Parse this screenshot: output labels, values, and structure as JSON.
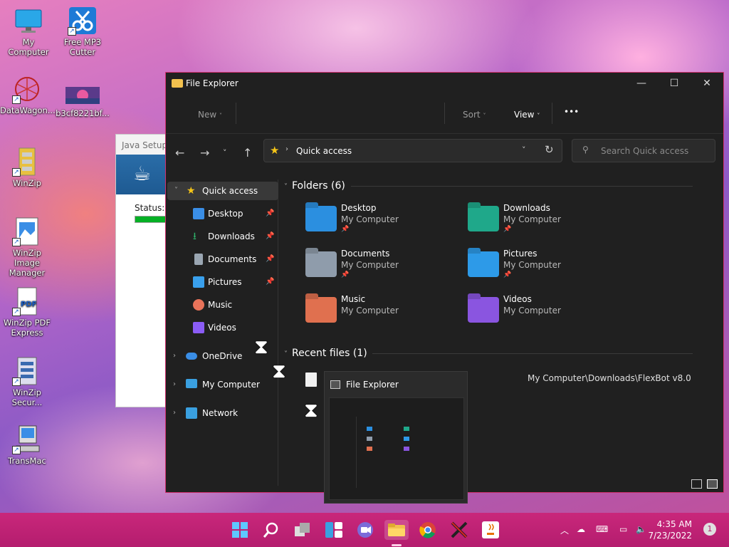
{
  "desktop": {
    "icons": [
      {
        "label": "My Computer",
        "icon": "monitor-icon"
      },
      {
        "label": "Free MP3 Cutter",
        "icon": "scissors-icon"
      },
      {
        "label": "DataWagon...",
        "icon": "network-icon"
      },
      {
        "label": "b3cf8221bf...",
        "icon": "image-icon"
      },
      {
        "label": "WinZip",
        "icon": "winzip-icon"
      },
      {
        "label": "WinZip Image Manager",
        "icon": "winzip-image-icon"
      },
      {
        "label": "WinZip PDF Express",
        "icon": "pdf-icon"
      },
      {
        "label": "WinZip Secur...",
        "icon": "winzip-secure-icon"
      },
      {
        "label": "TransMac",
        "icon": "mac-icon"
      }
    ]
  },
  "java_setup": {
    "title": "Java Setup",
    "status_label": "Status:",
    "progress": 0.3
  },
  "file_explorer": {
    "title": "File Explorer",
    "window_controls": {
      "minimize": "—",
      "maximize": "☐",
      "close": "✕"
    },
    "commands": {
      "new": "New",
      "sort": "Sort",
      "view": "View",
      "more": "•••"
    },
    "address": {
      "location": "Quick access"
    },
    "search": {
      "placeholder": "Search Quick access"
    },
    "nav": [
      {
        "label": "Quick access",
        "icon": "star-icon",
        "color": "#f5c518",
        "selected": true
      },
      {
        "label": "Desktop",
        "icon": "desktop-folder-icon",
        "color": "#3a8ee6",
        "pinned": true
      },
      {
        "label": "Downloads",
        "icon": "download-icon",
        "color": "#2fb36b",
        "pinned": true
      },
      {
        "label": "Documents",
        "icon": "document-icon",
        "color": "#9aa6b2",
        "pinned": true
      },
      {
        "label": "Pictures",
        "icon": "pictures-icon",
        "color": "#39a0ed",
        "pinned": true
      },
      {
        "label": "Music",
        "icon": "music-icon",
        "color": "#e8735a"
      },
      {
        "label": "Videos",
        "icon": "video-icon",
        "color": "#8b5cf6"
      },
      {
        "label": "OneDrive",
        "icon": "cloud-icon",
        "color": "#3a8ee6"
      },
      {
        "label": "My Computer",
        "icon": "computer-icon",
        "color": "#3aa0e0"
      },
      {
        "label": "Network",
        "icon": "network-icon",
        "color": "#3aa0e0"
      }
    ],
    "folders_section": {
      "title": "Folders (6)"
    },
    "folders": [
      {
        "name": "Desktop",
        "location": "My Computer",
        "pinned": true,
        "color": "#2b8fe0"
      },
      {
        "name": "Downloads",
        "location": "My Computer",
        "pinned": true,
        "color": "#1fa88a"
      },
      {
        "name": "Documents",
        "location": "My Computer",
        "pinned": true,
        "color": "#8f9cab"
      },
      {
        "name": "Pictures",
        "location": "My Computer",
        "pinned": true,
        "color": "#2d9ae8"
      },
      {
        "name": "Music",
        "location": "My Computer",
        "pinned": false,
        "color": "#e0704f"
      },
      {
        "name": "Videos",
        "location": "My Computer",
        "pinned": false,
        "color": "#8a55e0"
      }
    ],
    "recent_section": {
      "title": "Recent files (1)"
    },
    "recent_files": [
      {
        "path": "My Computer\\Downloads\\FlexBot v8.0"
      }
    ],
    "pin_glyph": "📌"
  },
  "thumbnail": {
    "title": "File Explorer"
  },
  "taskbar": {
    "apps": [
      "windows-start-icon",
      "search-icon",
      "task-view-icon",
      "widgets-icon",
      "chat-icon",
      "file-explorer-icon",
      "chrome-icon",
      "app-x-icon",
      "java-icon"
    ],
    "clock": {
      "time": "4:35 AM",
      "date": "7/23/2022"
    },
    "notifications": "1"
  }
}
